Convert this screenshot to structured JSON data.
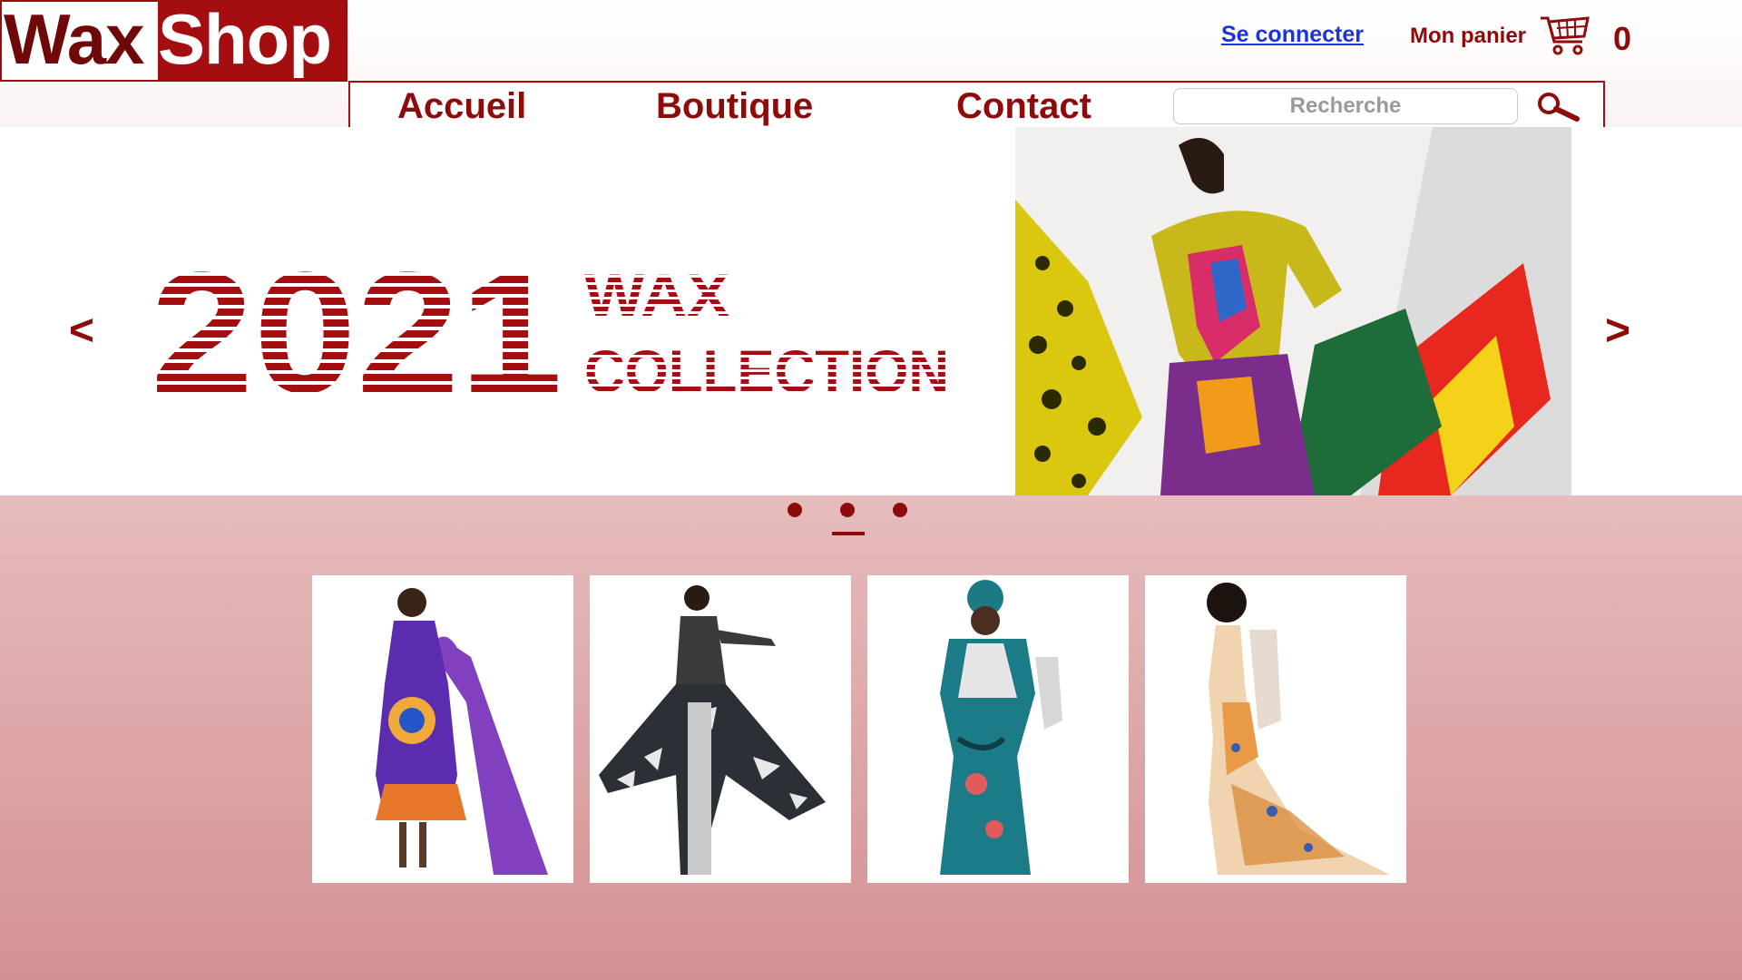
{
  "brand": {
    "part1": "Wax",
    "part2": "Shop"
  },
  "header": {
    "login": "Se connecter",
    "cart_label": "Mon panier",
    "cart_count": "0"
  },
  "nav": {
    "items": [
      "Accueil",
      "Boutique",
      "Contact"
    ],
    "search_placeholder": "Recherche"
  },
  "hero": {
    "prev": "<",
    "next": ">",
    "year": "2021",
    "line1": "WAX",
    "line2": "COLLECTION"
  },
  "carousel": {
    "slide_count": 3,
    "active_slide": 2
  },
  "products": [
    {
      "icon": "purple-wax-dress-photo"
    },
    {
      "icon": "black-white-wax-gown-photo"
    },
    {
      "icon": "teal-wax-dress-photo"
    },
    {
      "icon": "orange-mermaid-gown-photo"
    }
  ],
  "colors": {
    "brand_red": "#a40e10",
    "dark_red": "#8d0b0b",
    "link_blue": "#1a35d8"
  }
}
